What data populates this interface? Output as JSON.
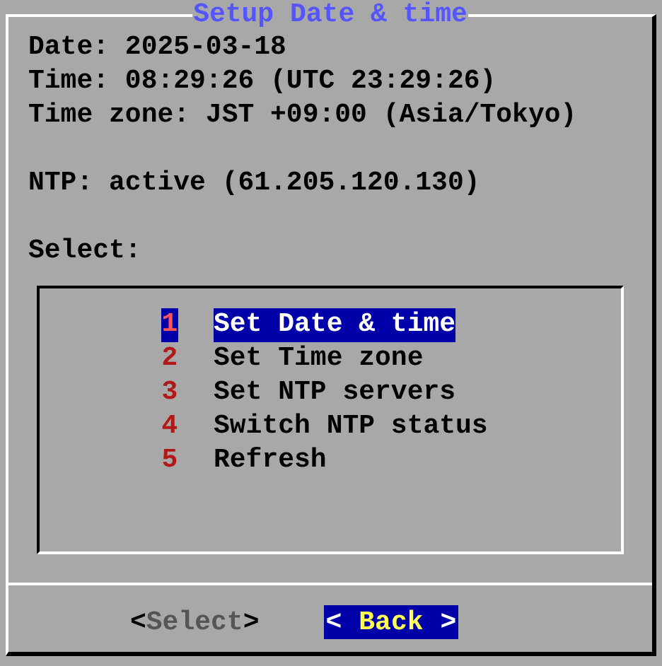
{
  "dialog": {
    "title": "Setup Date & time"
  },
  "clock_lines": [
    "Date: 2025-03-18",
    "Time: 08:29:26 (UTC 23:29:26)",
    "Time zone: JST +09:00 (Asia/Tokyo)"
  ],
  "ntp_line": "NTP: active (61.205.120.130)",
  "prompt": "Select:",
  "menu": [
    {
      "number": "1",
      "label": "Set Date & time",
      "selected": true
    },
    {
      "number": "2",
      "label": "Set Time zone",
      "selected": false
    },
    {
      "number": "3",
      "label": "Set NTP servers",
      "selected": false
    },
    {
      "number": "4",
      "label": "Switch NTP status",
      "selected": false
    },
    {
      "number": "5",
      "label": "Refresh",
      "selected": false
    }
  ],
  "buttons": [
    {
      "left": "<",
      "label": "Select",
      "right": ">",
      "selected": false
    },
    {
      "left": "<",
      "label": "Back",
      "right": ">",
      "selected": true
    }
  ]
}
